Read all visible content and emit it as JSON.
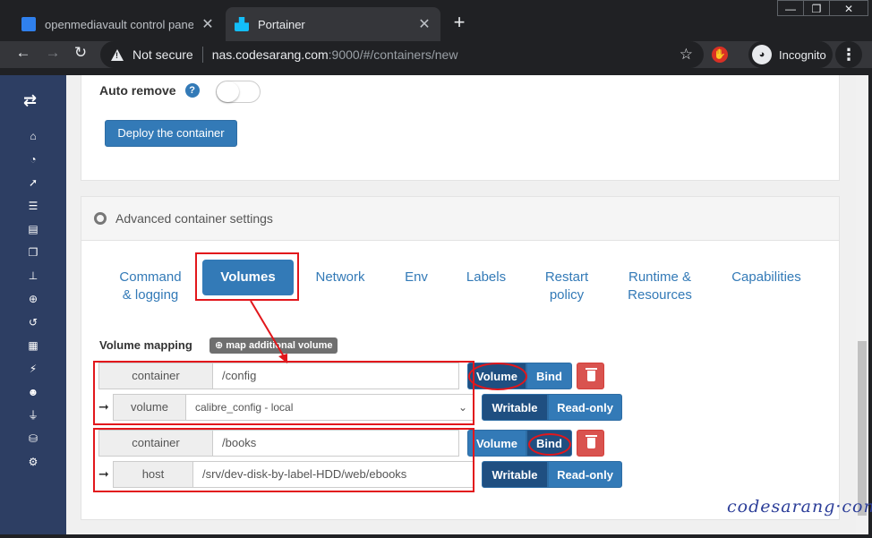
{
  "browser": {
    "tabs": [
      {
        "title": "openmediavault control panel - o",
        "active": false
      },
      {
        "title": "Portainer",
        "active": true
      }
    ],
    "new_tab": "+",
    "window_controls": [
      "—",
      "❐",
      "✕"
    ],
    "address": {
      "security_label": "Not secure",
      "host": "nas.codesarang.com",
      "path": ":9000/#/containers/new"
    },
    "extension_icon": "✋",
    "profile_label": "Incognito"
  },
  "sidebar": {
    "logo": "⇄",
    "items": [
      {
        "icon": "home-icon",
        "glyph": "⌂"
      },
      {
        "icon": "dashboard-icon",
        "glyph": "◔"
      },
      {
        "icon": "rocket-icon",
        "glyph": "➚"
      },
      {
        "icon": "list-icon",
        "glyph": "☰"
      },
      {
        "icon": "server-icon",
        "glyph": "▤"
      },
      {
        "icon": "clone-icon",
        "glyph": "❐"
      },
      {
        "icon": "sitemap-icon",
        "glyph": "⊥"
      },
      {
        "icon": "cubes-icon",
        "glyph": "⊕"
      },
      {
        "icon": "history-icon",
        "glyph": "↺"
      },
      {
        "icon": "th-icon",
        "glyph": "▦"
      },
      {
        "icon": "bolt-icon",
        "glyph": "⚡"
      },
      {
        "icon": "users-icon",
        "glyph": "☻"
      },
      {
        "icon": "plug-icon",
        "glyph": "⏚"
      },
      {
        "icon": "database-icon",
        "glyph": "⛁"
      },
      {
        "icon": "cogs-icon",
        "glyph": "⚙"
      }
    ]
  },
  "top_panel": {
    "auto_remove_label": "Auto remove",
    "help_glyph": "?",
    "auto_remove_enabled": false,
    "deploy_label": "Deploy the container"
  },
  "advanced": {
    "title": "Advanced container settings",
    "tabs": [
      {
        "line1": "Command",
        "line2": "& logging"
      },
      {
        "line1": "Volumes",
        "line2": ""
      },
      {
        "line1": "Network",
        "line2": ""
      },
      {
        "line1": "Env",
        "line2": ""
      },
      {
        "line1": "Labels",
        "line2": ""
      },
      {
        "line1": "Restart",
        "line2": "policy"
      },
      {
        "line1": "Runtime &",
        "line2": "Resources"
      },
      {
        "line1": "Capabilities",
        "line2": ""
      }
    ],
    "active_tab": "Volumes",
    "volume_mapping_label": "Volume mapping",
    "add_volume_label": "map additional volume",
    "mappings": [
      {
        "container_label": "container",
        "container_value": "/config",
        "kind_label": "volume",
        "kind_value": "calibre_config - local",
        "type_buttons": [
          "Volume",
          "Bind"
        ],
        "selected_type": "Volume",
        "mode_buttons": [
          "Writable",
          "Read-only"
        ],
        "selected_mode": "Writable"
      },
      {
        "container_label": "container",
        "container_value": "/books",
        "kind_label": "host",
        "kind_value": "/srv/dev-disk-by-label-HDD/web/ebooks",
        "type_buttons": [
          "Volume",
          "Bind"
        ],
        "selected_type": "Bind",
        "mode_buttons": [
          "Writable",
          "Read-only"
        ],
        "selected_mode": "Writable"
      }
    ],
    "arrow_glyph": "➞",
    "select_caret": "⌄"
  },
  "watermark": "codesarang·com",
  "colors": {
    "primary": "#337ab7",
    "primary_pressed": "#1f4f81",
    "danger": "#d9534f",
    "sidebar": "#2d3e63",
    "annotation": "#e2171c"
  }
}
